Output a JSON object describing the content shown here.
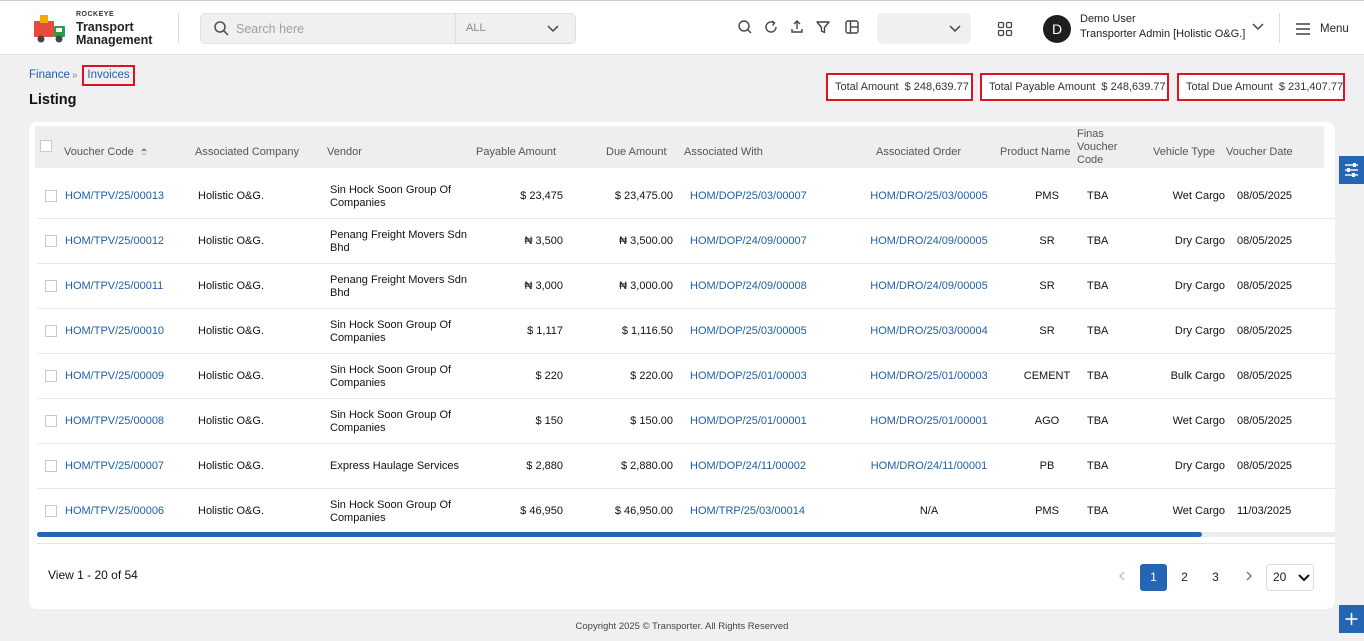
{
  "brand": {
    "small": "ROCKEYE",
    "line1": "Transport",
    "line2": "Management"
  },
  "search": {
    "placeholder": "Search here",
    "scope": "ALL"
  },
  "header_dropdown": {
    "value": ""
  },
  "user": {
    "initial": "D",
    "name": "Demo User",
    "role": "Transporter Admin [Holistic O&G.]"
  },
  "menu": {
    "label": "Menu"
  },
  "breadcrumb": {
    "parent": "Finance",
    "current": "Invoices"
  },
  "page": {
    "title": "Listing"
  },
  "totals": [
    {
      "label": "Total Amount",
      "amount": "$ 248,639.77"
    },
    {
      "label": "Total Payable Amount",
      "amount": "$ 248,639.77"
    },
    {
      "label": "Total Due Amount",
      "amount": "$ 231,407.77"
    }
  ],
  "table": {
    "columns": {
      "voucher_code": "Voucher Code",
      "associated_company": "Associated Company",
      "vendor": "Vendor",
      "payable_amount": "Payable Amount",
      "due_amount": "Due Amount",
      "associated_with": "Associated With",
      "associated_order": "Associated Order",
      "product_name": "Product Name",
      "finas_voucher_code_1": "Finas",
      "finas_voucher_code_2": "Voucher",
      "finas_voucher_code_3": "Code",
      "vehicle_type": "Vehicle Type",
      "voucher_date": "Voucher Date"
    },
    "rows": [
      {
        "code": "HOM/TPV/25/00013",
        "company": "Holistic O&G.",
        "vendor1": "Sin Hock Soon Group Of",
        "vendor2": "Companies",
        "payable": "$ 23,475",
        "due": "$ 23,475.00",
        "with": "HOM/DOP/25/03/00007",
        "order": "HOM/DRO/25/03/00005",
        "product": "PMS",
        "finas": "TBA",
        "vehicle": "Wet Cargo",
        "date": "08/05/2025"
      },
      {
        "code": "HOM/TPV/25/00012",
        "company": "Holistic O&G.",
        "vendor1": "Penang Freight Movers Sdn",
        "vendor2": "Bhd",
        "payable": "₦ 3,500",
        "due": "₦ 3,500.00",
        "with": "HOM/DOP/24/09/00007",
        "order": "HOM/DRO/24/09/00005",
        "product": "SR",
        "finas": "TBA",
        "vehicle": "Dry Cargo",
        "date": "08/05/2025"
      },
      {
        "code": "HOM/TPV/25/00011",
        "company": "Holistic O&G.",
        "vendor1": "Penang Freight Movers Sdn",
        "vendor2": "Bhd",
        "payable": "₦ 3,000",
        "due": "₦ 3,000.00",
        "with": "HOM/DOP/24/09/00008",
        "order": "HOM/DRO/24/09/00005",
        "product": "SR",
        "finas": "TBA",
        "vehicle": "Dry Cargo",
        "date": "08/05/2025"
      },
      {
        "code": "HOM/TPV/25/00010",
        "company": "Holistic O&G.",
        "vendor1": "Sin Hock Soon Group Of",
        "vendor2": "Companies",
        "payable": "$ 1,117",
        "due": "$ 1,116.50",
        "with": "HOM/DOP/25/03/00005",
        "order": "HOM/DRO/25/03/00004",
        "product": "SR",
        "finas": "TBA",
        "vehicle": "Dry Cargo",
        "date": "08/05/2025"
      },
      {
        "code": "HOM/TPV/25/00009",
        "company": "Holistic O&G.",
        "vendor1": "Sin Hock Soon Group Of",
        "vendor2": "Companies",
        "payable": "$ 220",
        "due": "$ 220.00",
        "with": "HOM/DOP/25/01/00003",
        "order": "HOM/DRO/25/01/00003",
        "product": "CEMENT",
        "finas": "TBA",
        "vehicle": "Bulk Cargo",
        "date": "08/05/2025"
      },
      {
        "code": "HOM/TPV/25/00008",
        "company": "Holistic O&G.",
        "vendor1": "Sin Hock Soon Group Of",
        "vendor2": "Companies",
        "payable": "$ 150",
        "due": "$ 150.00",
        "with": "HOM/DOP/25/01/00001",
        "order": "HOM/DRO/25/01/00001",
        "product": "AGO",
        "finas": "TBA",
        "vehicle": "Wet Cargo",
        "date": "08/05/2025"
      },
      {
        "code": "HOM/TPV/25/00007",
        "company": "Holistic O&G.",
        "vendor1": "Express Haulage Services",
        "vendor2": "",
        "payable": "$ 2,880",
        "due": "$ 2,880.00",
        "with": "HOM/DOP/24/11/00002",
        "order": "HOM/DRO/24/11/00001",
        "product": "PB",
        "finas": "TBA",
        "vehicle": "Dry Cargo",
        "date": "08/05/2025"
      },
      {
        "code": "HOM/TPV/25/00006",
        "company": "Holistic O&G.",
        "vendor1": "Sin Hock Soon Group Of",
        "vendor2": "Companies",
        "payable": "$ 46,950",
        "due": "$ 46,950.00",
        "with": "HOM/TRP/25/03/00014",
        "order": "N/A",
        "product": "PMS",
        "finas": "TBA",
        "vehicle": "Wet Cargo",
        "date": "11/03/2025"
      }
    ]
  },
  "pagination": {
    "info": "View 1 - 20 of 54",
    "pages": [
      "1",
      "2",
      "3"
    ],
    "current": "1",
    "page_size": "20"
  },
  "footer": {
    "text": "Copyright 2025 © Transporter. All Rights Reserved"
  }
}
